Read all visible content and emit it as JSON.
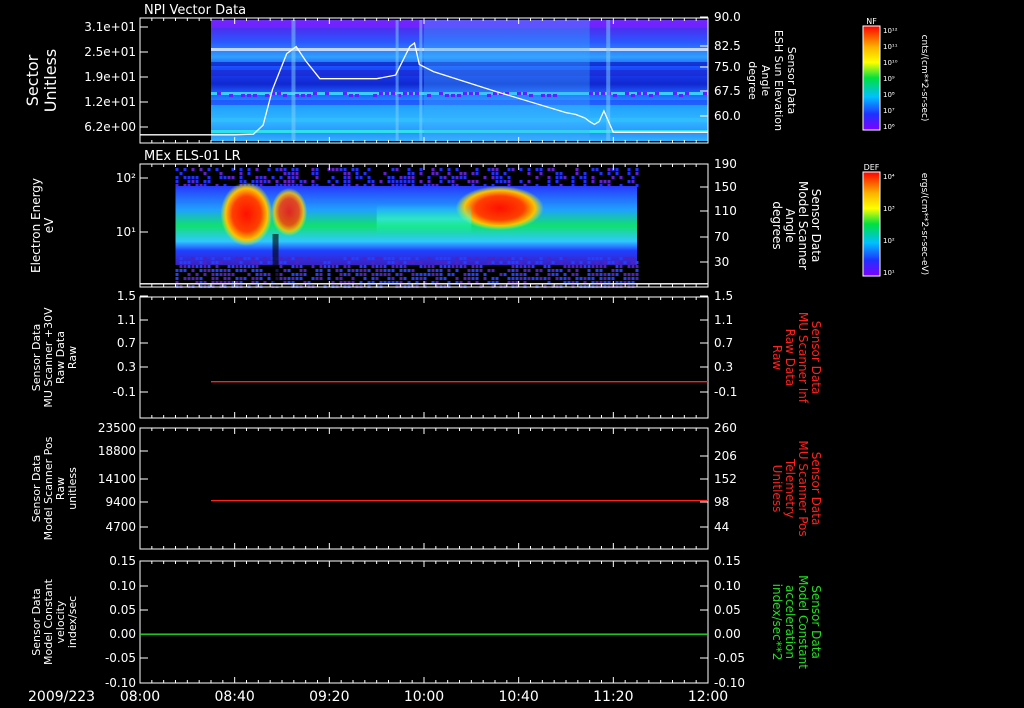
{
  "chart_data": [
    {
      "type": "heatmap",
      "title": "NPI Vector Data",
      "ylabel": [
        "Sector",
        "Unitless"
      ],
      "y_ticks": [
        "3.1e+01",
        "2.5e+01",
        "1.9e+01",
        "1.2e+01",
        "6.2e+00"
      ],
      "ylim": [
        0,
        31
      ],
      "right_axis": {
        "label": [
          "Sensor Data",
          "ESH Sun Elevation",
          "Angle",
          "degree"
        ],
        "ticks": [
          "90.0",
          "82.5",
          "75.0",
          "67.5",
          "60.0"
        ],
        "range": [
          55,
          90
        ],
        "color": "#ffffff"
      },
      "colorbar": {
        "title": "NF",
        "ticks": [
          "10¹²",
          "10¹¹",
          "10¹⁰",
          "10⁹",
          "10⁸",
          "10⁷",
          "10⁶"
        ],
        "unit": "cnts/(cm**2-sr-sec)"
      },
      "data_extent": [
        "08:30",
        "12:00"
      ],
      "series": [
        {
          "axis": "right",
          "color": "#ffffff",
          "x": [
            "08:00",
            "08:40",
            "08:48",
            "08:52",
            "08:56",
            "09:02",
            "09:06",
            "09:10",
            "09:16",
            "09:20",
            "09:40",
            "09:48",
            "09:54",
            "09:56",
            "09:58",
            "10:04",
            "10:30",
            "11:00",
            "11:04",
            "11:08",
            "11:10",
            "11:12",
            "11:14",
            "11:16",
            "11:20",
            "12:00"
          ],
          "values": [
            57.3,
            57.3,
            57.5,
            60,
            70,
            80,
            82,
            78,
            73,
            73,
            73,
            74,
            82,
            83,
            77,
            75,
            69.5,
            63.5,
            63,
            62,
            61,
            60.2,
            61,
            64,
            58,
            58
          ]
        }
      ]
    },
    {
      "type": "heatmap",
      "title": "MEx ELS-01 LR",
      "ylabel": [
        "Electron Energy",
        "eV"
      ],
      "y_ticks": [
        "10²",
        "10¹"
      ],
      "yscale": "log",
      "right_axis": {
        "label": [
          "Sensor Data",
          "Model Scanner",
          "Angle",
          "degrees"
        ],
        "ticks": [
          "190",
          "150",
          "110",
          "70",
          "30"
        ],
        "range": [
          0,
          190
        ],
        "color": "#ffffff"
      },
      "colorbar": {
        "title": "DEF",
        "ticks": [
          "10⁴",
          "10³",
          "10²",
          "10¹"
        ],
        "unit": "ergs/(cm**2-sr-sec-eV)"
      },
      "data_extent": [
        "08:15",
        "11:30"
      ],
      "series": [
        {
          "axis": "right",
          "color": "#ffffff",
          "x": [
            "08:00",
            "12:00"
          ],
          "values": [
            5,
            5
          ]
        }
      ]
    },
    {
      "type": "line",
      "ylabel": [
        "Sensor Data",
        "MU Scanner +30V",
        "Raw Data",
        "Raw"
      ],
      "y_ticks": [
        "1.5",
        "1.1",
        "0.7",
        "0.3",
        "-0.1"
      ],
      "ylim": [
        -0.5,
        1.5
      ],
      "right_axis": {
        "label": [
          "Sensor Data",
          "MU Scanner Inf",
          "Raw Data",
          "Raw"
        ],
        "ticks": [
          "1.5",
          "1.1",
          "0.7",
          "0.3",
          "-0.1"
        ],
        "range": [
          -0.5,
          1.5
        ],
        "color": "#ff2020"
      },
      "series": [
        {
          "axis": "right",
          "color": "#ff2020",
          "x": [
            "08:30",
            "12:00"
          ],
          "values": [
            0.1,
            0.1
          ]
        }
      ]
    },
    {
      "type": "line",
      "ylabel": [
        "Sensor Data",
        "Model Scanner Pos",
        "Raw",
        "unitless"
      ],
      "y_ticks": [
        "23500",
        "18800",
        "14100",
        "9400",
        "4700"
      ],
      "ylim": [
        0,
        23500
      ],
      "right_axis": {
        "label": [
          "Sensor Data",
          "MU Scanner Pos",
          "Telemetry",
          "Unitless"
        ],
        "ticks": [
          "260",
          "206",
          "152",
          "98",
          "44"
        ],
        "range": [
          -10,
          260
        ],
        "color": "#ff2020"
      },
      "series": [
        {
          "axis": "right",
          "color": "#ff2020",
          "x": [
            "08:30",
            "12:00"
          ],
          "values": [
            98,
            98
          ]
        }
      ]
    },
    {
      "type": "line",
      "ylabel": [
        "Sensor Data",
        "Model Constant",
        "velocity",
        "index/sec"
      ],
      "y_ticks": [
        "0.15",
        "0.10",
        "0.05",
        "0.00",
        "-0.05",
        "-0.10"
      ],
      "ylim": [
        -0.1,
        0.15
      ],
      "right_axis": {
        "label": [
          "Sensor Data",
          "Model Constant",
          "acceleration",
          "index/sec**2"
        ],
        "ticks": [
          "0.15",
          "0.10",
          "0.05",
          "0.00",
          "-0.05",
          "-0.10"
        ],
        "range": [
          -0.1,
          0.15
        ],
        "color": "#20e020"
      },
      "series": [
        {
          "axis": "left",
          "color": "#20e020",
          "x": [
            "08:00",
            "12:00"
          ],
          "values": [
            0,
            0
          ]
        }
      ]
    }
  ],
  "x_axis": {
    "date": "2009/223",
    "tick_labels": [
      "08:00",
      "08:40",
      "09:20",
      "10:00",
      "10:40",
      "11:20",
      "12:00"
    ],
    "range": [
      "08:00",
      "12:00"
    ]
  },
  "colors": {
    "background": "#000000",
    "axis": "#ffffff",
    "red_trace": "#ff2020",
    "green_trace": "#20e020"
  }
}
